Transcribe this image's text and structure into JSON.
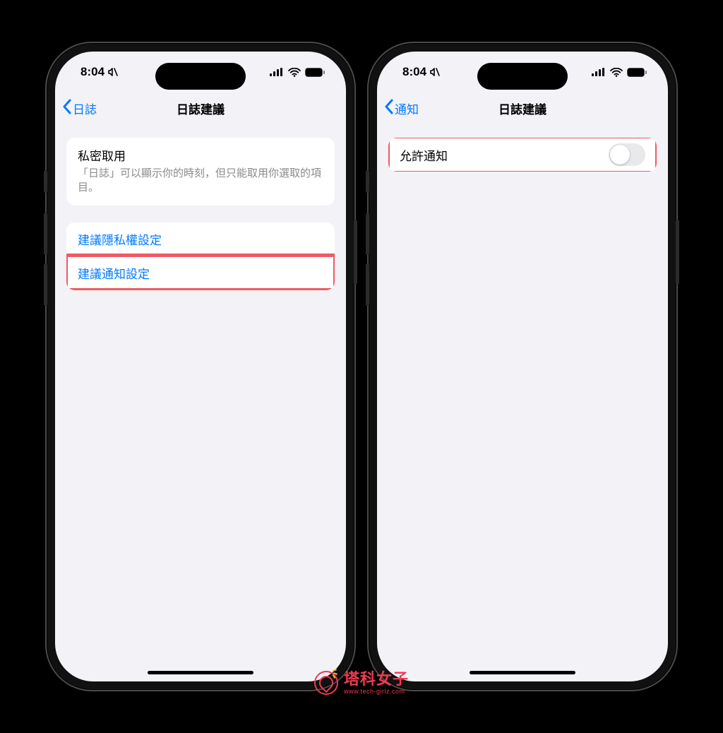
{
  "status": {
    "time": "8:04"
  },
  "left_phone": {
    "nav": {
      "back_label": "日誌",
      "title": "日誌建議"
    },
    "card": {
      "title": "私密取用",
      "desc": "「日誌」可以顯示你的時刻，但只能取用你選取的項目。"
    },
    "links": {
      "privacy": "建議隱私權設定",
      "notifications": "建議通知設定"
    }
  },
  "right_phone": {
    "nav": {
      "back_label": "通知",
      "title": "日誌建議"
    },
    "allow_notifications_label": "允許通知",
    "allow_notifications_on": false
  },
  "watermark": {
    "main": "塔科女子",
    "sub": "www.tech-girlz.com"
  },
  "colors": {
    "accent": "#007aff",
    "highlight": "#ef5a63",
    "brand": "#ee3b52"
  }
}
